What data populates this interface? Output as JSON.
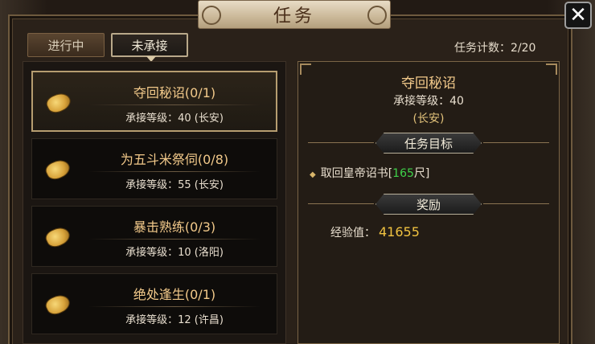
{
  "dialog": {
    "title": "任务",
    "close_glyph": "✕"
  },
  "tabs": [
    {
      "label": "进行中",
      "active": false
    },
    {
      "label": "未承接",
      "active": true
    }
  ],
  "quest_count": {
    "label": "任务计数：",
    "value": "2/20"
  },
  "quests": [
    {
      "name": "夺回秘诏(0/1)",
      "level_label": "承接等级：",
      "level": "40",
      "city": "(长安)",
      "selected": true
    },
    {
      "name": "为五斗米祭伺(0/8)",
      "level_label": "承接等级：",
      "level": "55",
      "city": "(长安)",
      "selected": false
    },
    {
      "name": "暴击熟练(0/3)",
      "level_label": "承接等级：",
      "level": "10",
      "city": "(洛阳)",
      "selected": false
    },
    {
      "name": "绝处逢生(0/1)",
      "level_label": "承接等级：",
      "level": "12",
      "city": "(许昌)",
      "selected": false
    }
  ],
  "detail": {
    "title": "夺回秘诏",
    "level_text": "承接等级：40",
    "city": "(长安)",
    "objective_header": "任务目标",
    "objective": {
      "text": "取回皇帝诏书[",
      "value": "165",
      "suffix": "尺]"
    },
    "reward_header": "奖励",
    "reward": {
      "label": "经验值：",
      "value": "41655"
    }
  },
  "colors": {
    "quest_name": "#f2c98a",
    "objective_value": "#3fd24a",
    "reward_value": "#f0c240"
  }
}
